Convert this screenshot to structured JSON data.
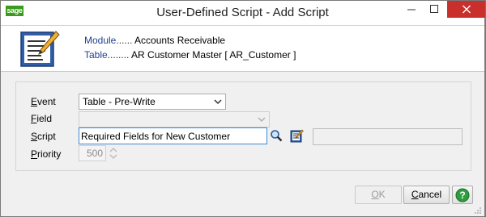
{
  "window": {
    "title": "User-Defined Script - Add Script",
    "app_logo_text": "sage",
    "controls": {
      "minimize": "minimize",
      "maximize": "maximize",
      "close": "close"
    }
  },
  "header": {
    "icon": "script-document-icon",
    "module_label": "Module",
    "module_dots": "......",
    "module_value": "Accounts Receivable",
    "table_label": "Table",
    "table_dots": "........",
    "table_value": "AR Customer Master  [ AR_Customer ]"
  },
  "form": {
    "event_label_first": "E",
    "event_label_rest": "vent",
    "event_value": "Table - Pre-Write",
    "field_label_first": "F",
    "field_label_rest": "ield",
    "field_value": "",
    "script_label_first": "S",
    "script_label_rest": "cript",
    "script_value": "Required Fields for New Customer",
    "priority_label_first": "P",
    "priority_label_rest": "riority",
    "priority_value": "500"
  },
  "buttons": {
    "ok_first": "O",
    "ok_rest": "K",
    "cancel_first": "C",
    "cancel_rest": "ancel"
  },
  "colors": {
    "logo_green": "#3c9a1c",
    "close_red": "#c9302c",
    "label_blue": "#1f3f8f",
    "focus_blue": "#3c8ad8",
    "help_green": "#2e9d3e"
  }
}
